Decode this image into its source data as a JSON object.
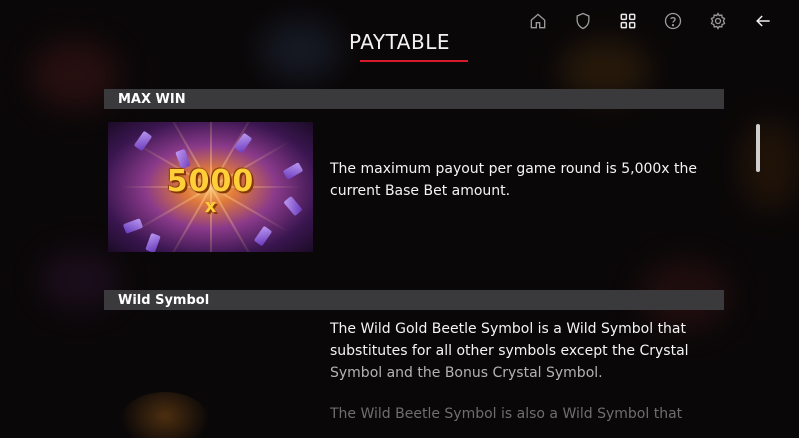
{
  "toolbar": {
    "items": [
      {
        "name": "home",
        "icon": "home-icon"
      },
      {
        "name": "shield",
        "icon": "shield-icon"
      },
      {
        "name": "grid",
        "icon": "grid-icon"
      },
      {
        "name": "help",
        "icon": "help-icon"
      },
      {
        "name": "settings",
        "icon": "gear-icon"
      },
      {
        "name": "back",
        "icon": "arrow-left-icon"
      }
    ]
  },
  "title": "PAYTABLE",
  "accent_color": "#d81a2c",
  "sections": {
    "max_win": {
      "header": "MAX WIN",
      "image_text": "5000",
      "image_suffix": "x",
      "text": "The maximum payout per game round is 5,000x the current Base Bet amount."
    },
    "wild_symbol": {
      "header": "Wild Symbol",
      "text_1": "The Wild Gold Beetle Symbol is a Wild Symbol that",
      "text_2": "substitutes for all other symbols except the Crystal",
      "text_3": "Symbol and the Bonus Crystal Symbol.",
      "text_4": "The Wild Beetle Symbol is also a Wild Symbol that"
    }
  }
}
